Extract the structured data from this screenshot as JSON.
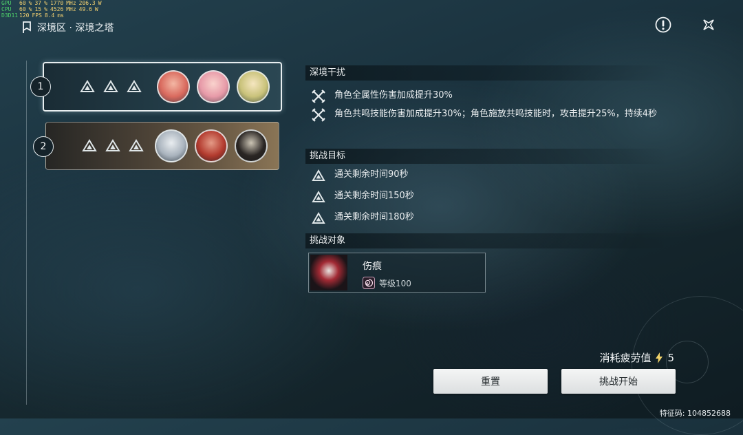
{
  "overlay": {
    "rows": [
      {
        "label": "GPU",
        "v1": "60",
        "u1": "%",
        "v2": "37",
        "u2": "%",
        "v3": "1770",
        "u3": "MHz",
        "v4": "206.3",
        "u4": "W"
      },
      {
        "label": "CPU",
        "v1": "60",
        "u1": "%",
        "v2": "15",
        "u2": "%",
        "v3": "4526",
        "u3": "MHz",
        "v4": "49.6",
        "u4": "W"
      },
      {
        "label": "D3D11",
        "v1": "120",
        "u1": "FPS",
        "v2": "8.4",
        "u2": "ms",
        "v3": "",
        "u3": "",
        "v4": "",
        "u4": ""
      }
    ]
  },
  "header": {
    "title": "深境区 · 深境之塔"
  },
  "icons": {
    "location": "location-flag-icon",
    "info": "exclamation-icon",
    "close": "close-star-icon"
  },
  "stages": [
    {
      "number": "1",
      "selected": true,
      "stars": 3
    },
    {
      "number": "2",
      "selected": false,
      "stars": 3
    }
  ],
  "sections": {
    "interference": {
      "heading": "深境干扰",
      "items": [
        "角色全属性伤害加成提升30%",
        "角色共鸣技能伤害加成提升30%；角色施放共鸣技能时，攻击提升25%，持续4秒"
      ]
    },
    "goals": {
      "heading": "挑战目标",
      "items": [
        "通关剩余时间90秒",
        "通关剩余时间150秒",
        "通关剩余时间180秒"
      ]
    },
    "target": {
      "heading": "挑战对象",
      "enemy_name": "伤痕",
      "enemy_level": "等级100"
    }
  },
  "cost": {
    "label": "消耗疲劳值",
    "value": "5"
  },
  "buttons": {
    "reset": "重置",
    "start": "挑战开始"
  },
  "feature_code": "特征码: 104852688",
  "colors": {
    "accent": "#f1d36a",
    "panel_selected_border": "#e8eef0"
  }
}
